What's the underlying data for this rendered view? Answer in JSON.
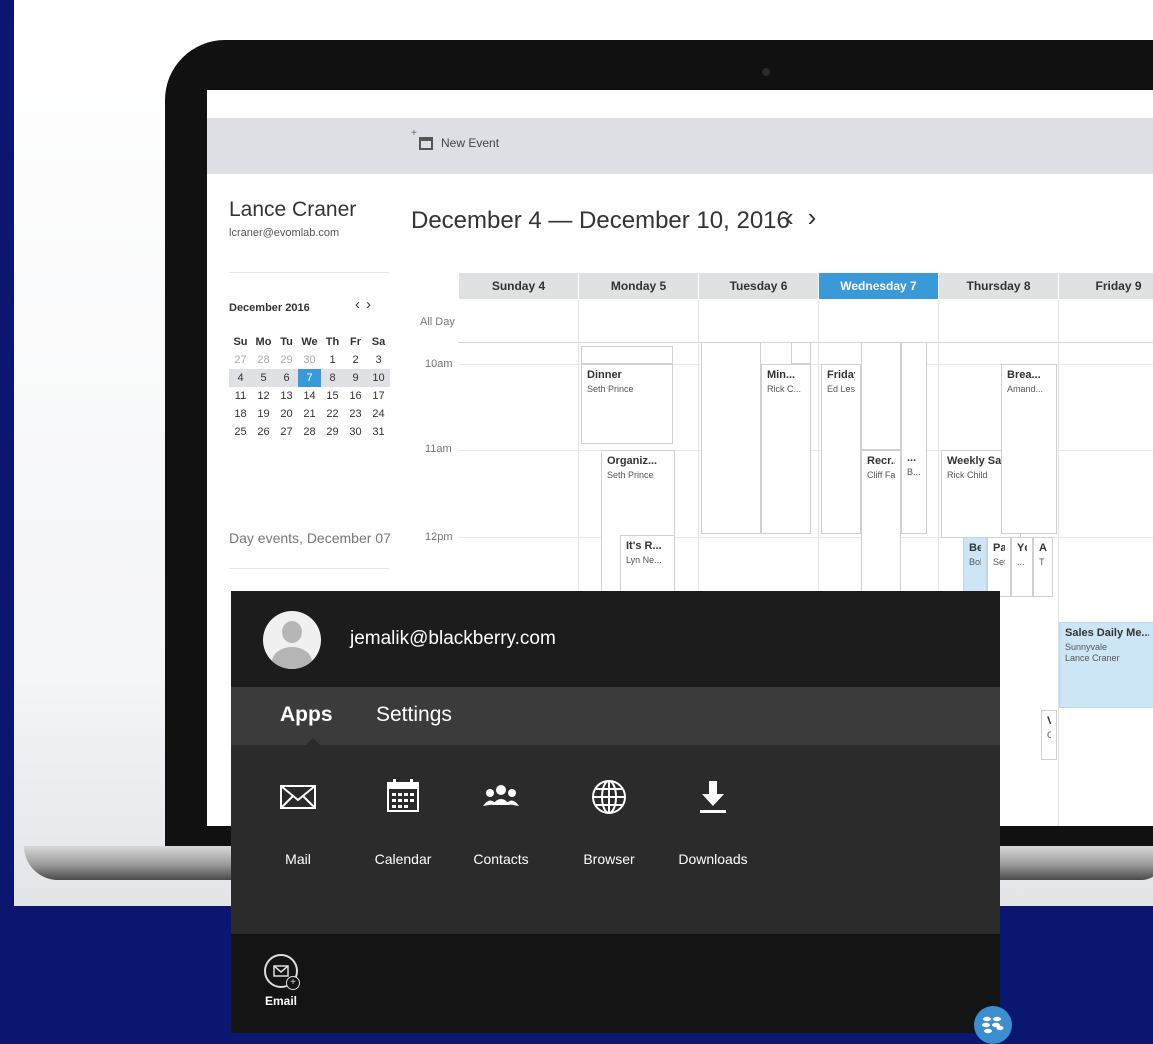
{
  "calendar": {
    "toolbar": {
      "new_event_label": "New Event"
    },
    "user": {
      "name": "Lance Craner",
      "email": "lcraner@evomlab.com"
    },
    "mini_calendar": {
      "month_label": "December 2016",
      "weekday_headers": [
        "Su",
        "Mo",
        "Tu",
        "We",
        "Th",
        "Fr",
        "Sa"
      ],
      "weeks": [
        [
          "27",
          "28",
          "29",
          "30",
          "1",
          "2",
          "3"
        ],
        [
          "4",
          "5",
          "6",
          "7",
          "8",
          "9",
          "10"
        ],
        [
          "11",
          "12",
          "13",
          "14",
          "15",
          "16",
          "17"
        ],
        [
          "18",
          "19",
          "20",
          "21",
          "22",
          "23",
          "24"
        ],
        [
          "25",
          "26",
          "27",
          "28",
          "29",
          "30",
          "31"
        ]
      ],
      "selected_day": "7"
    },
    "day_events_label": "Day events, December 07",
    "week_title": "December 4 — December 10, 2016",
    "day_headers": [
      "Sunday 4",
      "Monday 5",
      "Tuesday 6",
      "Wednesday 7",
      "Thursday 8",
      "Friday 9"
    ],
    "today_header": "Wednesday 7",
    "all_day_label": "All Day",
    "time_labels": [
      "10am",
      "11am",
      "12pm"
    ],
    "events": [
      {
        "title": "Dinner",
        "subtitle": "Seth Prince"
      },
      {
        "title": "Min...",
        "subtitle": "Rick C..."
      },
      {
        "title": "Friday",
        "subtitle": "Ed Lesli"
      },
      {
        "title": "Brea...",
        "subtitle": "Amand..."
      },
      {
        "title": "Organiz...",
        "subtitle": "Seth Prince"
      },
      {
        "title": "Recr...",
        "subtitle": "Cliff Fal"
      },
      {
        "title": "...",
        "subtitle": "B..."
      },
      {
        "title": "Weekly Sal",
        "subtitle": "Rick Child"
      },
      {
        "title": "It's R...",
        "subtitle": "Lyn Ne..."
      },
      {
        "title": "Ber",
        "subtitle": "Bob"
      },
      {
        "title": "Par",
        "subtitle": "Seth"
      },
      {
        "title": "Yc",
        "subtitle": "..."
      },
      {
        "title": "A",
        "subtitle": "T"
      },
      {
        "title": "Sales Daily Me...",
        "subtitle": "Sunnyvale",
        "subtitle2": "Lance Craner"
      },
      {
        "title": "V",
        "subtitle": "C"
      }
    ]
  },
  "overlay": {
    "email": "jemalik@blackberry.com",
    "tabs": [
      "Apps",
      "Settings"
    ],
    "active_tab": "Apps",
    "apps": [
      {
        "label": "Mail",
        "icon": "mail-icon"
      },
      {
        "label": "Calendar",
        "icon": "calendar-icon"
      },
      {
        "label": "Contacts",
        "icon": "contacts-icon"
      },
      {
        "label": "Browser",
        "icon": "globe-icon"
      },
      {
        "label": "Downloads",
        "icon": "download-icon"
      }
    ],
    "dock": [
      {
        "label": "Email",
        "icon": "email-add-icon"
      }
    ]
  },
  "colors": {
    "background": "#0b1670",
    "today_accent": "#3a9ad9",
    "event_highlight": "#cde6f5",
    "overlay_dark": "#2b2b2b",
    "blackberry_blue": "#3b8ed0"
  }
}
